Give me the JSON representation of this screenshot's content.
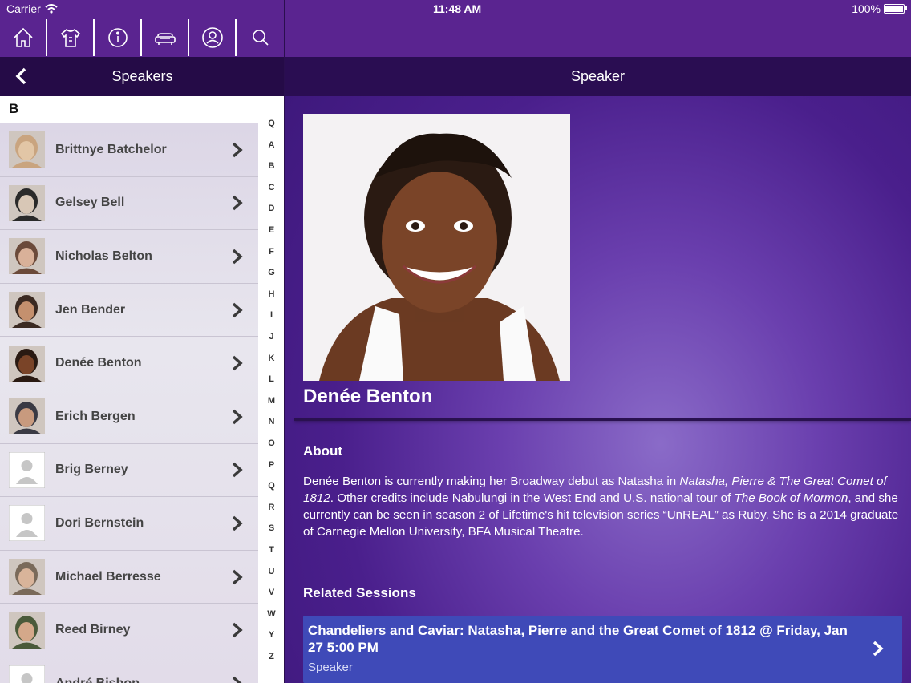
{
  "status_bar": {
    "carrier": "Carrier",
    "time": "11:48 AM",
    "battery": "100%"
  },
  "toolbar": {
    "icons": [
      "home-icon",
      "tshirt-icon",
      "info-icon",
      "sofa-icon",
      "person-icon",
      "search-icon"
    ]
  },
  "left_nav": {
    "title": "Speakers"
  },
  "right_nav": {
    "title": "Speaker"
  },
  "section_header": "B",
  "speakers": [
    {
      "name": "Brittnye Batchelor"
    },
    {
      "name": "Gelsey Bell"
    },
    {
      "name": "Nicholas Belton"
    },
    {
      "name": "Jen Bender"
    },
    {
      "name": "Denée Benton"
    },
    {
      "name": "Erich Bergen"
    },
    {
      "name": "Brig Berney"
    },
    {
      "name": "Dori Bernstein"
    },
    {
      "name": "Michael Berresse"
    },
    {
      "name": "Reed Birney"
    },
    {
      "name": "André Bishop"
    }
  ],
  "index_letters": [
    "Q",
    "A",
    "B",
    "C",
    "D",
    "E",
    "F",
    "G",
    "H",
    "I",
    "J",
    "K",
    "L",
    "M",
    "N",
    "O",
    "P",
    "Q",
    "R",
    "S",
    "T",
    "U",
    "V",
    "W",
    "Y",
    "Z"
  ],
  "detail": {
    "name": "Denée Benton",
    "about_heading": "About",
    "about_parts": [
      "Denée Benton is currently making her Broadway debut as Natasha in ",
      "Natasha, Pierre & The Great Comet of 1812",
      ". Other credits include Nabulungi in the West End and U.S. national tour of ",
      "The Book of Mormon",
      ", and she currently can be seen in season 2 of Lifetime's hit television series “UnREAL” as Ruby. She is a 2014 graduate of Carnegie Mellon University, BFA Musical Theatre."
    ],
    "related_heading": "Related Sessions",
    "session": {
      "title": "Chandeliers and Caviar: Natasha, Pierre and the Great Comet of 1812 @ Friday, Jan 27 5:00 PM",
      "role": "Speaker"
    }
  },
  "colors": {
    "toolbar_bg": "#5a2490",
    "nav_bg": "#250b47",
    "session_bg": "#3f4ab8"
  }
}
